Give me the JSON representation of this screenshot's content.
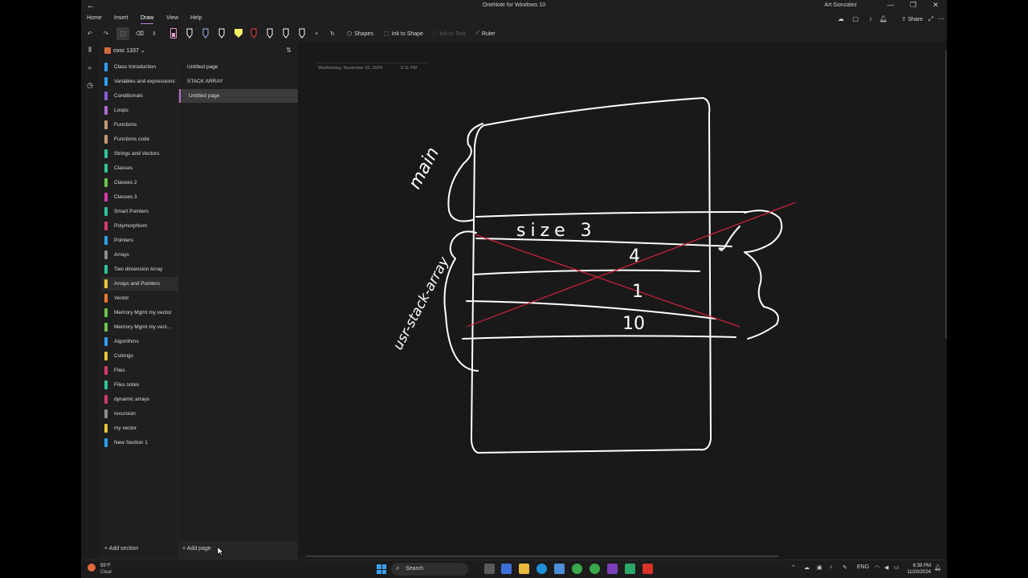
{
  "window": {
    "title": "OneNote for Windows 10",
    "user": "Art Gonzalez",
    "back_glyph": "←",
    "minimize_glyph": "—",
    "maximize_glyph": "❐",
    "close_glyph": "✕"
  },
  "menu": {
    "tabs": [
      "Home",
      "Insert",
      "Draw",
      "View",
      "Help"
    ],
    "active": "Draw",
    "share": "Share"
  },
  "ribbon": {
    "shapes": "Shapes",
    "ink_to_shape": "Ink to Shape",
    "ink_to_text": "Ink to Text",
    "ruler": "Ruler",
    "pen_colors": [
      "#e8a0d0",
      "#ffffff",
      "#9ec3ff",
      "#ffffff",
      "#f5f06a",
      "#ff4040",
      "#ffffff",
      "#ffffff",
      "#ffffff",
      "#ffffff"
    ]
  },
  "notebook": {
    "name": "cosc 1337",
    "sort_glyph": "⇅"
  },
  "sections": [
    {
      "label": "Class Introduction",
      "color": "#2d9ff0"
    },
    {
      "label": "Variables and expressions",
      "color": "#2d9ff0"
    },
    {
      "label": "Conditionals",
      "color": "#8a5cd6"
    },
    {
      "label": "Loops",
      "color": "#b06ad3"
    },
    {
      "label": "Functions",
      "color": "#c49a74"
    },
    {
      "label": "Functions code",
      "color": "#c49a74"
    },
    {
      "label": "Strings and Vectors",
      "color": "#2fc39a"
    },
    {
      "label": "Classes",
      "color": "#2fc39a"
    },
    {
      "label": "Classes 2",
      "color": "#6cc24a"
    },
    {
      "label": "Classes 3",
      "color": "#d63aa8"
    },
    {
      "label": "Smart Pointers",
      "color": "#2fc39a"
    },
    {
      "label": "Polymorphism",
      "color": "#d63a6a"
    },
    {
      "label": "Pointers",
      "color": "#2d9ff0"
    },
    {
      "label": "Arrays",
      "color": "#8c8c8c"
    },
    {
      "label": "Two dimension Array",
      "color": "#2fc39a"
    },
    {
      "label": "Arrays and Pointers",
      "color": "#e8c43a"
    },
    {
      "label": "Vector",
      "color": "#e87a2a"
    },
    {
      "label": "Memory Mgmt my vector",
      "color": "#6cc24a"
    },
    {
      "label": "Memory Mgmt my vect...",
      "color": "#6cc24a"
    },
    {
      "label": "Algorithms",
      "color": "#2d9ff0"
    },
    {
      "label": "Cstrings",
      "color": "#e8c43a"
    },
    {
      "label": "Files",
      "color": "#d63a6a"
    },
    {
      "label": "Files notes",
      "color": "#2fc39a"
    },
    {
      "label": "dynamic arrays",
      "color": "#d63a6a"
    },
    {
      "label": "recursion",
      "color": "#8c8c8c"
    },
    {
      "label": "my vector",
      "color": "#e8c43a"
    },
    {
      "label": "New Section 1",
      "color": "#2d9ff0"
    }
  ],
  "selected_section": "Arrays and Pointers",
  "pages": [
    {
      "label": "Untitled page"
    },
    {
      "label": "STACK ARRAY"
    },
    {
      "label": "Untitled page"
    }
  ],
  "selected_page_index": 2,
  "footer": {
    "add_section": "Add section",
    "add_page": "Add page"
  },
  "page": {
    "date": "Wednesday, November 20, 2024",
    "time": "6:11 PM"
  },
  "ink_text": {
    "main": "main",
    "size": "size  3",
    "four": "4",
    "one": "1",
    "ten": "10",
    "side_label": "usr-stack-array"
  },
  "taskbar": {
    "temperature": "55°F",
    "condition": "Clear",
    "search": "Search",
    "lang": "ENG",
    "clock_time": "6:39 PM",
    "clock_date": "11/20/2024"
  }
}
